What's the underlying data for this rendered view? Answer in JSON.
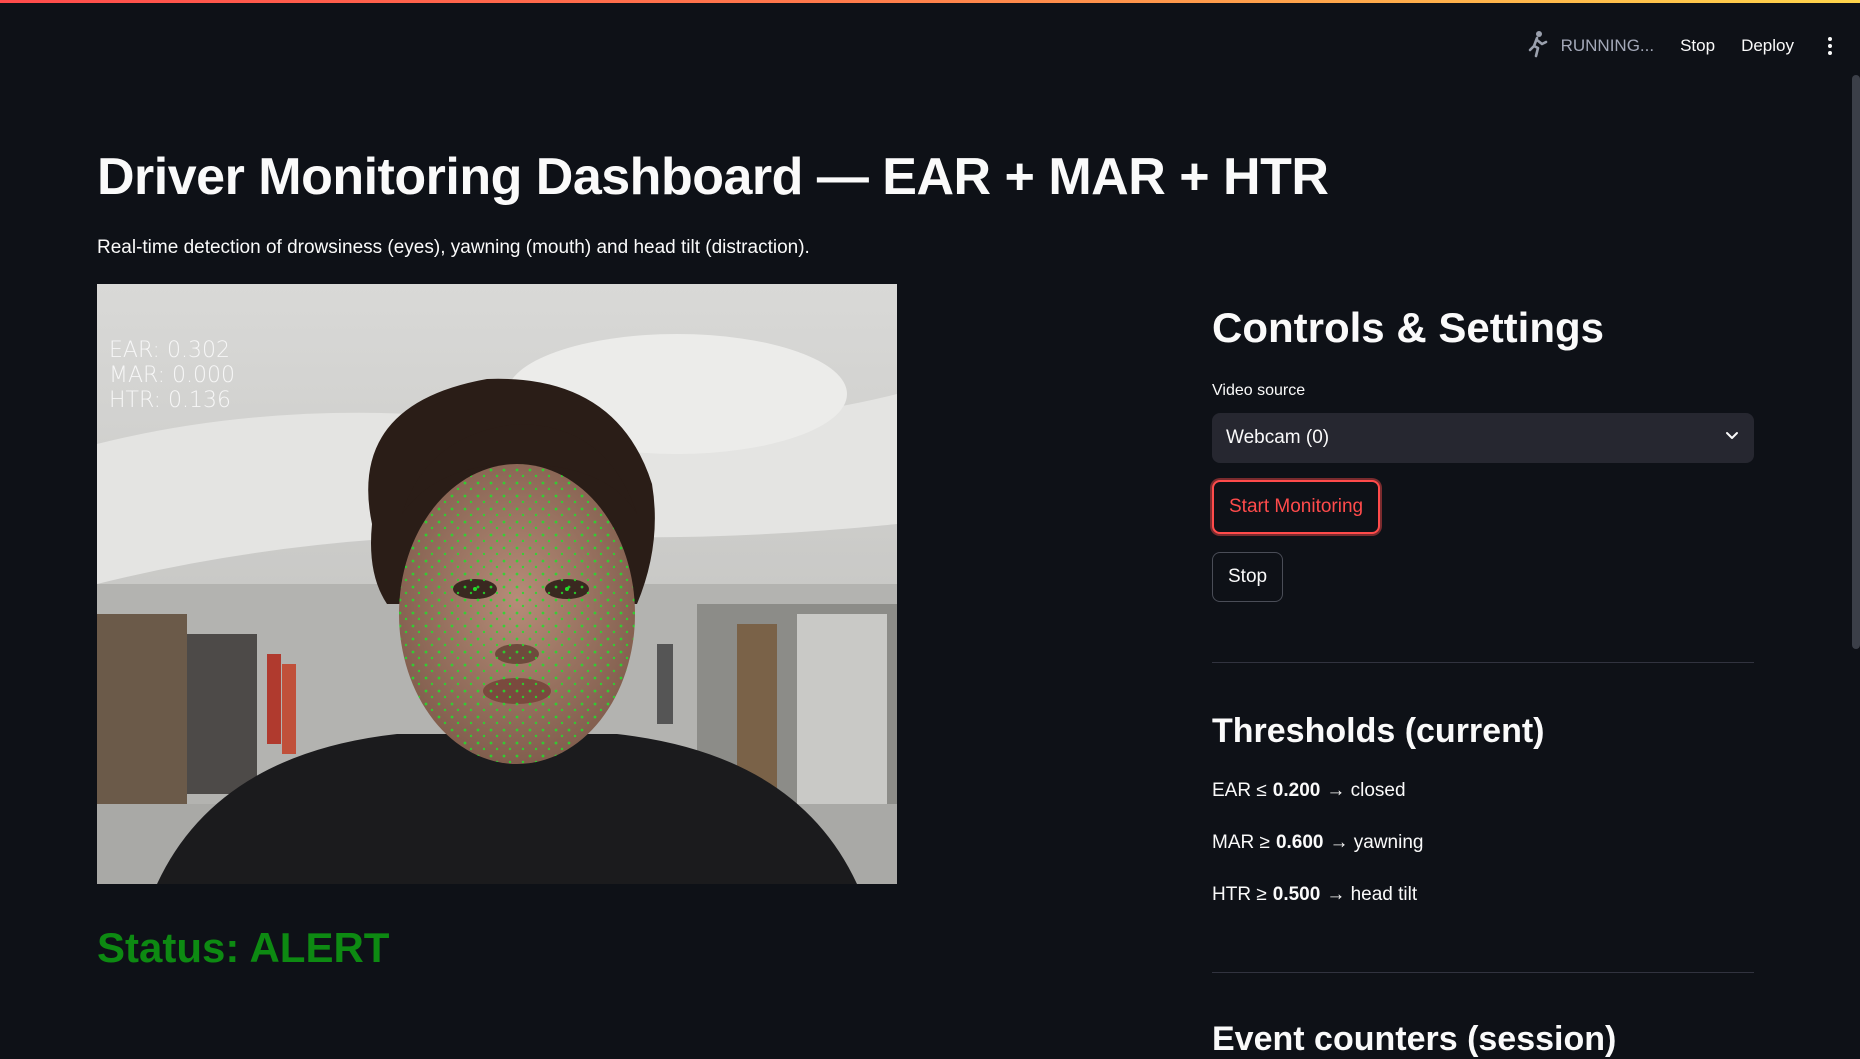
{
  "header": {
    "running_icon": "running-person-icon",
    "running_label": "RUNNING...",
    "stop_label": "Stop",
    "deploy_label": "Deploy",
    "menu_icon": "kebab-menu-icon"
  },
  "main": {
    "title": "Driver Monitoring Dashboard — EAR + MAR + HTR",
    "subtitle": "Real-time detection of drowsiness (eyes), yawning (mouth) and head tilt (distraction).",
    "overlay": {
      "ear": "EAR: 0.302",
      "mar": "MAR: 0.000",
      "htr": "HTR: 0.136"
    },
    "status": "Status: ALERT"
  },
  "sidebar": {
    "controls_title": "Controls & Settings",
    "video_source_label": "Video source",
    "video_source_value": "Webcam (0)",
    "start_button": "Start Monitoring",
    "stop_button": "Stop",
    "thresholds_title": "Thresholds (current)",
    "thresholds": [
      {
        "prefix": "EAR ≤",
        "value": "0.200",
        "suffix": "→ closed"
      },
      {
        "prefix": "MAR ≥",
        "value": "0.600",
        "suffix": "→ yawning"
      },
      {
        "prefix": "HTR ≥",
        "value": "0.500",
        "suffix": "→ head tilt"
      }
    ],
    "counters_title": "Event counters (session)"
  },
  "colors": {
    "background": "#0e1117",
    "accent": "#ff4b4b",
    "status_alert": "#0d8a12",
    "landmarks": "#22e02a"
  }
}
